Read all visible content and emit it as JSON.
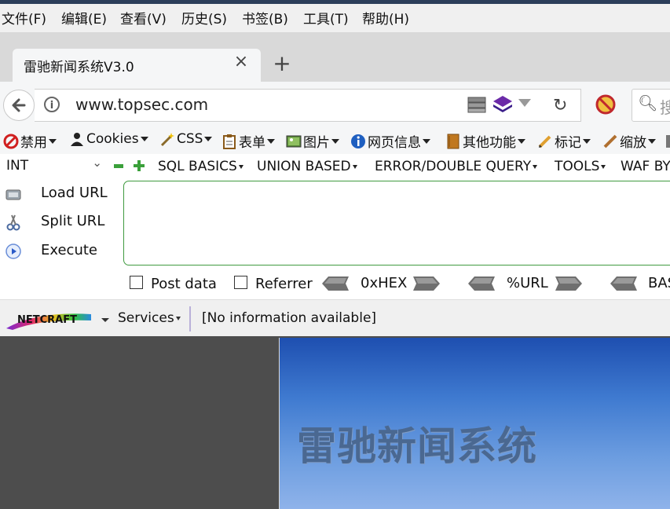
{
  "menu": [
    "文件(F)",
    "编辑(E)",
    "查看(V)",
    "历史(S)",
    "书签(B)",
    "工具(T)",
    "帮助(H)"
  ],
  "tab": {
    "title": "雷驰新闻系统V3.0",
    "close": "×",
    "new": "+"
  },
  "nav": {
    "url": "www.topsec.com",
    "search_placeholder": "搜"
  },
  "addon_toolbar": [
    {
      "label": "禁用",
      "icon": "disable-icon"
    },
    {
      "label": "Cookies",
      "icon": "cookies-icon"
    },
    {
      "label": "CSS",
      "icon": "css-icon"
    },
    {
      "label": "表单",
      "icon": "forms-icon"
    },
    {
      "label": "图片",
      "icon": "images-icon"
    },
    {
      "label": "网页信息",
      "icon": "info-icon"
    },
    {
      "label": "其他功能",
      "icon": "misc-icon"
    },
    {
      "label": "标记",
      "icon": "outline-icon"
    },
    {
      "label": "缩放",
      "icon": "resize-icon"
    }
  ],
  "hackbar": {
    "type_select": "INT",
    "menus": [
      "SQL BASICS",
      "UNION BASED",
      "ERROR/DOUBLE QUERY",
      "TOOLS",
      "WAF BY"
    ],
    "load_url": "Load URL",
    "split_url": "Split URL",
    "execute": "Execute",
    "url_value": "",
    "post_data": "Post data",
    "referrer": "Referrer",
    "encoders": [
      "0xHEX",
      "%URL",
      "BAS"
    ]
  },
  "netcraft": {
    "logo": "NETCRAFT",
    "services": "Services",
    "info": "[No information available]"
  },
  "page": {
    "banner_title": "雷驰新闻系统"
  },
  "colors": {
    "hackbar_border": "#3f9a3f",
    "banner_top": "#1e4fb0",
    "banner_bottom": "#8fb3ea",
    "banner_text": "#4a6891"
  }
}
